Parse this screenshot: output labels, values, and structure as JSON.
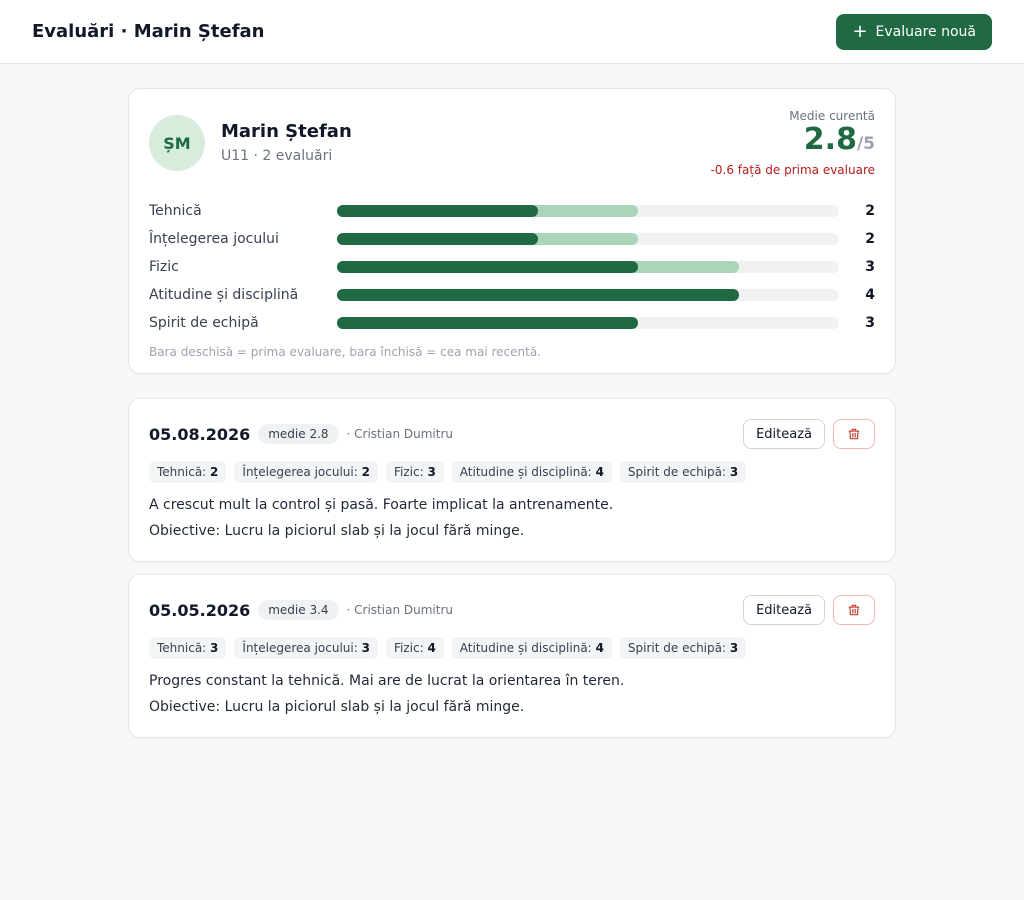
{
  "header": {
    "title": "Evaluări · Marin Ștefan",
    "new_button_icon": "plus-icon",
    "new_button_label": "Evaluare nouă"
  },
  "player": {
    "initials": "ȘM",
    "name": "Marin Ștefan",
    "subtitle": "U11 · 2 evaluări",
    "average_label": "Medie curentă",
    "average": "2.8",
    "average_of": "/5",
    "delta": "-0.6 față de prima evaluare"
  },
  "bars": {
    "max": 5,
    "items": [
      {
        "label": "Tehnică",
        "first": 3,
        "recent": 2,
        "display": "2"
      },
      {
        "label": "Înțelegerea jocului",
        "first": 3,
        "recent": 2,
        "display": "2"
      },
      {
        "label": "Fizic",
        "first": 4,
        "recent": 3,
        "display": "3"
      },
      {
        "label": "Atitudine și disciplină",
        "first": 4,
        "recent": 4,
        "display": "4"
      },
      {
        "label": "Spirit de echipă",
        "first": 3,
        "recent": 3,
        "display": "3"
      }
    ],
    "note": "Bara deschisă = prima evaluare, bara închisă = cea mai recentă."
  },
  "evaluations": [
    {
      "date": "05.08.2026",
      "badge": "medie 2.8",
      "coach": "· Cristian Dumitru",
      "edit_label": "Editează",
      "delete_icon": "trash-icon",
      "chips": [
        {
          "label": "Tehnică:",
          "value": "2"
        },
        {
          "label": "Înțelegerea jocului:",
          "value": "2"
        },
        {
          "label": "Fizic:",
          "value": "3"
        },
        {
          "label": "Atitudine și disciplină:",
          "value": "4"
        },
        {
          "label": "Spirit de echipă:",
          "value": "3"
        }
      ],
      "comment": "A crescut mult la control și pasă. Foarte implicat la antrenamente.",
      "objectives_label": "Obiective:",
      "objectives": "Lucru la piciorul slab și la jocul fără minge."
    },
    {
      "date": "05.05.2026",
      "badge": "medie 3.4",
      "coach": "· Cristian Dumitru",
      "edit_label": "Editează",
      "delete_icon": "trash-icon",
      "chips": [
        {
          "label": "Tehnică:",
          "value": "3"
        },
        {
          "label": "Înțelegerea jocului:",
          "value": "3"
        },
        {
          "label": "Fizic:",
          "value": "4"
        },
        {
          "label": "Atitudine și disciplină:",
          "value": "4"
        },
        {
          "label": "Spirit de echipă:",
          "value": "3"
        }
      ],
      "comment": "Progres constant la tehnică. Mai are de lucrat la orientarea în teren.",
      "objectives_label": "Obiective:",
      "objectives": "Lucru la piciorul slab și la jocul fără minge."
    }
  ],
  "colors": {
    "accent": "#1f6a42",
    "first_bar": "#a9d6b8",
    "delta_negative": "#b91c1c"
  }
}
